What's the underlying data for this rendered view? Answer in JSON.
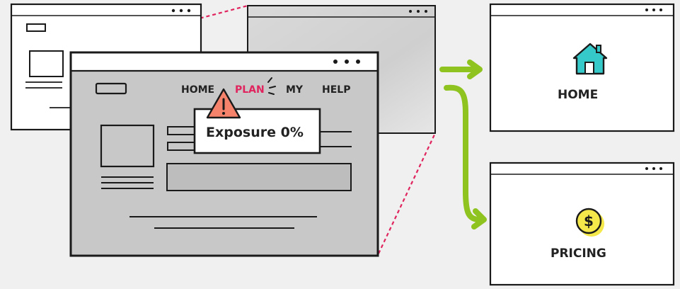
{
  "nav": {
    "items": [
      "HOME",
      "PLAN",
      "MY",
      "HELP"
    ],
    "active_index": 1,
    "active_color": "#e0245e"
  },
  "tooltip": {
    "text": "Exposure 0%",
    "icon": "warning-icon"
  },
  "destinations": [
    {
      "label": "HOME",
      "icon": "house-icon",
      "icon_color": "#36c9c9"
    },
    {
      "label": "PRICING",
      "icon": "dollar-coin-icon",
      "icon_color": "#f4e84a"
    }
  ],
  "colors": {
    "arrow": "#8fc31f",
    "zoom_lines": "#e0245e",
    "warning": "#f5826b",
    "page_fill": "#c8c8c8",
    "outline": "#1a1a1a"
  }
}
